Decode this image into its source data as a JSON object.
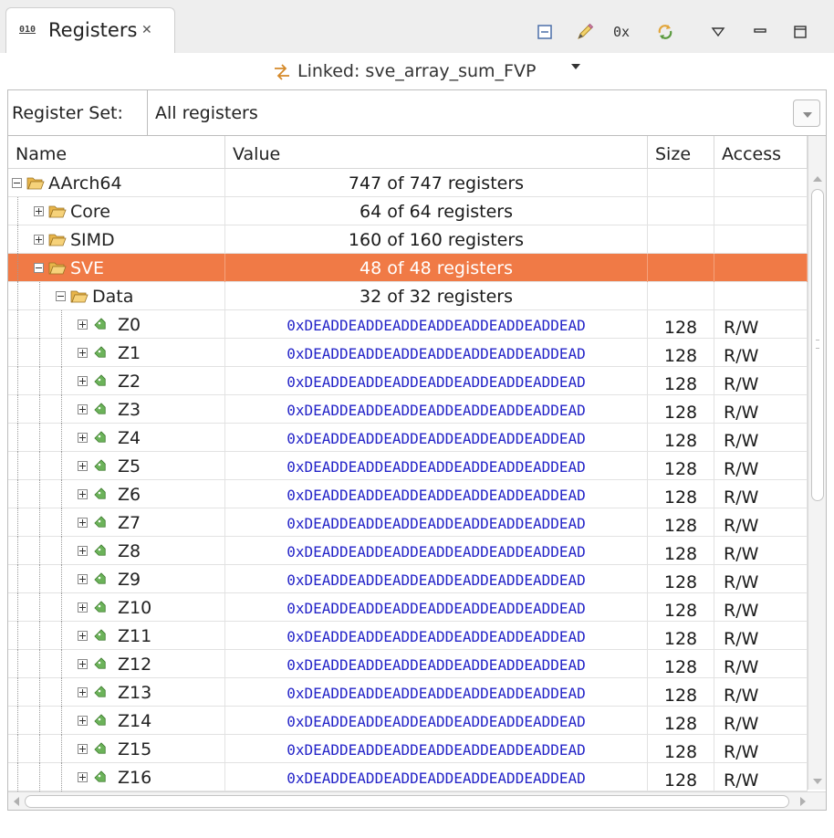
{
  "tab": {
    "title": "Registers",
    "icon_text": "010"
  },
  "toolbar": {
    "hex_label": "0x"
  },
  "linked": {
    "text": "Linked: sve_array_sum_FVP"
  },
  "register_set": {
    "label": "Register Set:",
    "value": "All registers"
  },
  "columns": {
    "name": "Name",
    "value": "Value",
    "size": "Size",
    "access": "Access"
  },
  "rows": [
    {
      "name": "AArch64",
      "value": "747 of 747 registers",
      "size": "",
      "access": ""
    },
    {
      "name": "Core",
      "value": "64 of 64 registers",
      "size": "",
      "access": ""
    },
    {
      "name": "SIMD",
      "value": "160 of 160 registers",
      "size": "",
      "access": ""
    },
    {
      "name": "SVE",
      "value": "48 of 48 registers",
      "size": "",
      "access": ""
    },
    {
      "name": "Data",
      "value": "32 of 32 registers",
      "size": "",
      "access": ""
    },
    {
      "name": "Z0",
      "value": "0xDEADDEADDEADDEADDEADDEADDEADDEAD",
      "size": "128",
      "access": "R/W"
    },
    {
      "name": "Z1",
      "value": "0xDEADDEADDEADDEADDEADDEADDEADDEAD",
      "size": "128",
      "access": "R/W"
    },
    {
      "name": "Z2",
      "value": "0xDEADDEADDEADDEADDEADDEADDEADDEAD",
      "size": "128",
      "access": "R/W"
    },
    {
      "name": "Z3",
      "value": "0xDEADDEADDEADDEADDEADDEADDEADDEAD",
      "size": "128",
      "access": "R/W"
    },
    {
      "name": "Z4",
      "value": "0xDEADDEADDEADDEADDEADDEADDEADDEAD",
      "size": "128",
      "access": "R/W"
    },
    {
      "name": "Z5",
      "value": "0xDEADDEADDEADDEADDEADDEADDEADDEAD",
      "size": "128",
      "access": "R/W"
    },
    {
      "name": "Z6",
      "value": "0xDEADDEADDEADDEADDEADDEADDEADDEAD",
      "size": "128",
      "access": "R/W"
    },
    {
      "name": "Z7",
      "value": "0xDEADDEADDEADDEADDEADDEADDEADDEAD",
      "size": "128",
      "access": "R/W"
    },
    {
      "name": "Z8",
      "value": "0xDEADDEADDEADDEADDEADDEADDEADDEAD",
      "size": "128",
      "access": "R/W"
    },
    {
      "name": "Z9",
      "value": "0xDEADDEADDEADDEADDEADDEADDEADDEAD",
      "size": "128",
      "access": "R/W"
    },
    {
      "name": "Z10",
      "value": "0xDEADDEADDEADDEADDEADDEADDEADDEAD",
      "size": "128",
      "access": "R/W"
    },
    {
      "name": "Z11",
      "value": "0xDEADDEADDEADDEADDEADDEADDEADDEAD",
      "size": "128",
      "access": "R/W"
    },
    {
      "name": "Z12",
      "value": "0xDEADDEADDEADDEADDEADDEADDEADDEAD",
      "size": "128",
      "access": "R/W"
    },
    {
      "name": "Z13",
      "value": "0xDEADDEADDEADDEADDEADDEADDEADDEAD",
      "size": "128",
      "access": "R/W"
    },
    {
      "name": "Z14",
      "value": "0xDEADDEADDEADDEADDEADDEADDEADDEAD",
      "size": "128",
      "access": "R/W"
    },
    {
      "name": "Z15",
      "value": "0xDEADDEADDEADDEADDEADDEADDEADDEAD",
      "size": "128",
      "access": "R/W"
    },
    {
      "name": "Z16",
      "value": "0xDEADDEADDEADDEADDEADDEADDEADDEAD",
      "size": "128",
      "access": "R/W"
    }
  ],
  "selected_row": "SVE",
  "colors": {
    "selection": "#f07a46",
    "hex_value": "#2424c8",
    "register_icon": "#6cb35a",
    "folder": "#e8b54a"
  }
}
